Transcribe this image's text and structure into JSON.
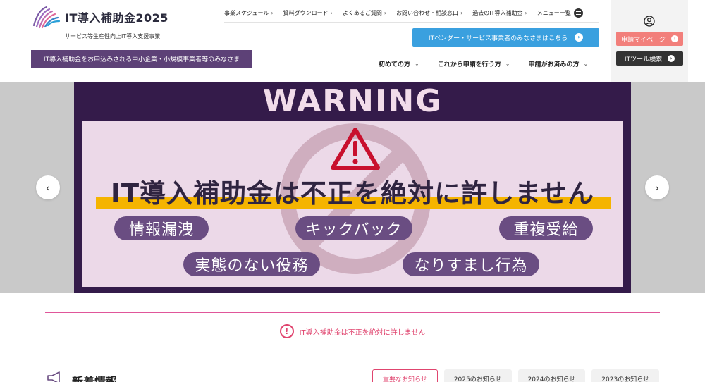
{
  "header": {
    "logo_title": "IT導入補助金2025",
    "logo_subtitle": "サービス等生産性向上IT導入支援事業",
    "banner_text": "IT導入補助金をお申込みされる中小企業・小規模事業者等のみなさま",
    "top_nav": [
      {
        "label": "事業スケジュール"
      },
      {
        "label": "資料ダウンロード"
      },
      {
        "label": "よくあるご質問"
      },
      {
        "label": "お問い合わせ・相談窓口"
      },
      {
        "label": "過去のIT導入補助金"
      },
      {
        "label": "メニュー一覧"
      }
    ],
    "vendor_button": "ITベンダー・サービス事業者のみなさまはこちら",
    "main_nav": [
      {
        "label": "初めての方"
      },
      {
        "label": "これから申請を行う方"
      },
      {
        "label": "申請がお済みの方"
      }
    ],
    "mypage_button": "申請マイページ",
    "tool_search_button": "ITツール検索"
  },
  "hero": {
    "warning": "WARNING",
    "headline": "IT導入補助金は不正を絶対に許しません",
    "pills": [
      "情報漏洩",
      "キックバック",
      "重複受給",
      "実態のない役務",
      "なりすまし行為"
    ],
    "prev_glyph": "‹",
    "next_glyph": "›",
    "colors": {
      "dark": "#341b4a",
      "panel": "#ecd9e8",
      "pill": "#6a4d82",
      "highlight": "#f5b400",
      "alert_red": "#c8102e"
    }
  },
  "alert": {
    "icon_glyph": "!",
    "text": "IT導入補助金は不正を絶対に許しません"
  },
  "news": {
    "title": "新着情報",
    "tabs": [
      {
        "label": "重要なお知らせ",
        "active": true
      },
      {
        "label": "2025のお知らせ",
        "active": false
      },
      {
        "label": "2024のお知らせ",
        "active": false
      },
      {
        "label": "2023のお知らせ",
        "active": false
      }
    ]
  },
  "icons": {
    "chevron": "›",
    "chevron_down": "⌄",
    "arrow_right": "›"
  }
}
